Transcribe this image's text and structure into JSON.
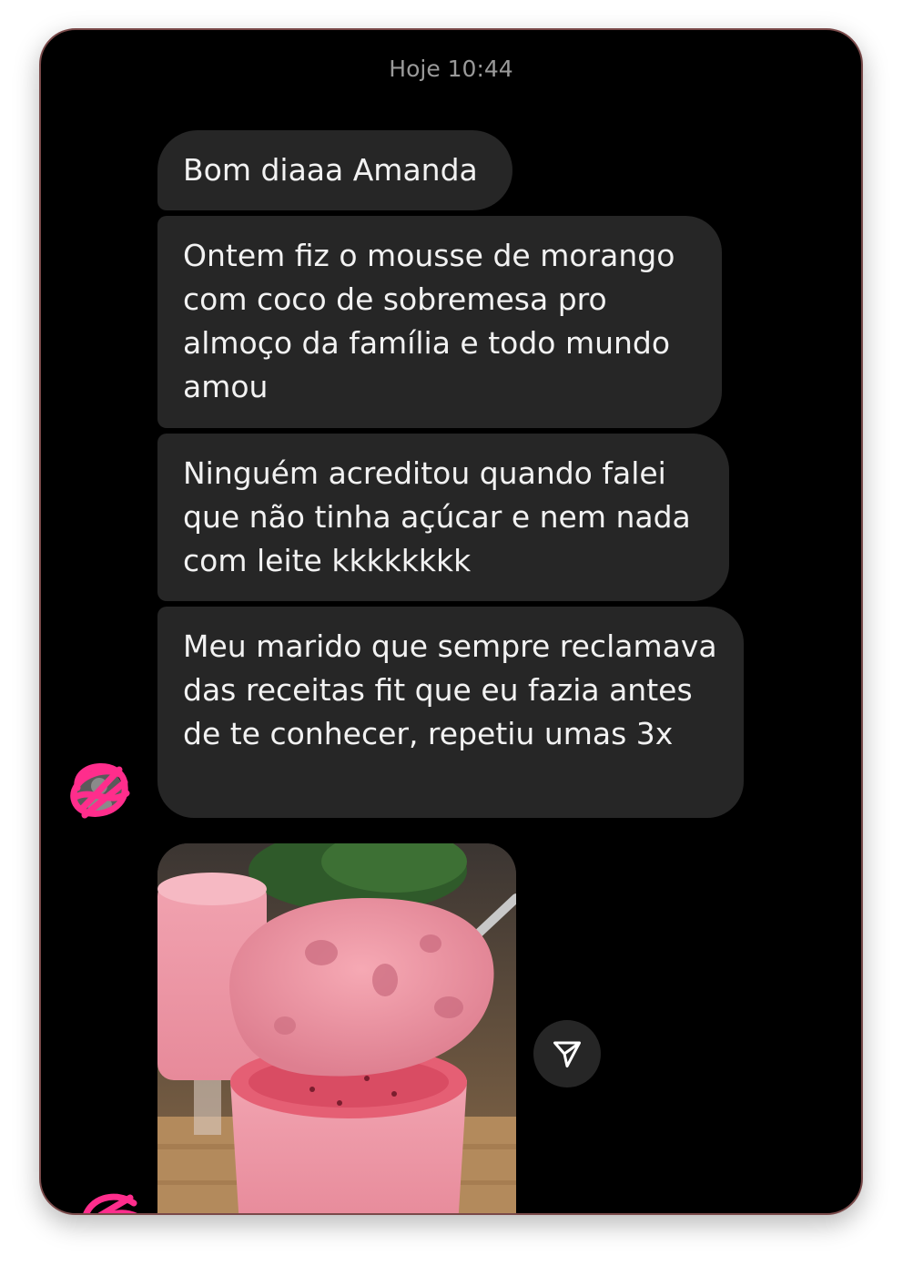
{
  "chat": {
    "timestamp": "Hoje 10:44",
    "messages": [
      {
        "text": "Bom diaaa Amanda"
      },
      {
        "text": "Ontem fiz o mousse de morango com coco de sobremesa pro almoço da família e todo mundo amou"
      },
      {
        "text": "Ninguém acreditou quando falei que não tinha açúcar e nem nada com leite kkkkkkkk"
      },
      {
        "text": "Meu marido que sempre reclamava das receitas fit que eu fazia antes de te conhecer, repetiu umas 3x"
      }
    ],
    "media": {
      "icon": "mousse-photo"
    },
    "share_icon": "paper-plane-icon",
    "colors": {
      "background": "#000000",
      "bubble": "#262626",
      "text": "#f2f2f2",
      "timestamp": "#9a9a9a",
      "avatar_scribble": "#ff2d8c"
    }
  }
}
